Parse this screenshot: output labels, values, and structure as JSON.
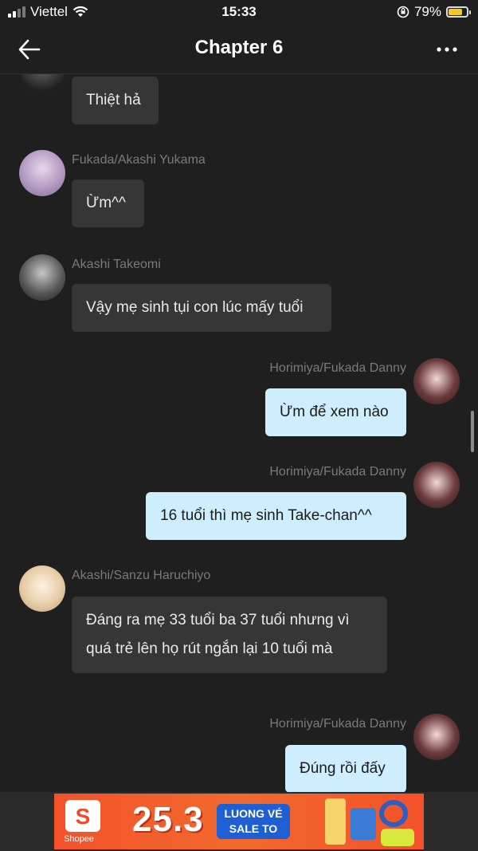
{
  "status_bar": {
    "carrier": "Viettel",
    "time": "15:33",
    "battery": "79%",
    "battery_level": 0.79
  },
  "header": {
    "title": "Chapter 6"
  },
  "messages": [
    {
      "name": "",
      "text": "Thiệt hả"
    },
    {
      "name": "Fukada/Akashi Yukama",
      "text": "Ừm^^"
    },
    {
      "name": "Akashi Takeomi",
      "text": "Vậy mẹ sinh tụi con lúc mấy tuổi"
    },
    {
      "name": "Horimiya/Fukada Danny",
      "text": "Ừm để xem nào"
    },
    {
      "name": "Horimiya/Fukada Danny",
      "text": "16 tuổi thì mẹ sinh Take-chan^^"
    },
    {
      "name": "Akashi/Sanzu Haruchiyo",
      "text": "Đáng ra mẹ 33 tuổi ba 37 tuổi nhưng vì quá trẻ lên họ rút ngắn lại 10 tuổi mà"
    },
    {
      "name": "Horimiya/Fukada Danny",
      "text": "Đúng rồi đấy"
    }
  ],
  "ad": {
    "brand": "Shopee",
    "logo_letter": "S",
    "headline": "25.3",
    "promo_line1": "LUONG VÉ",
    "promo_line2": "SALE TO"
  }
}
